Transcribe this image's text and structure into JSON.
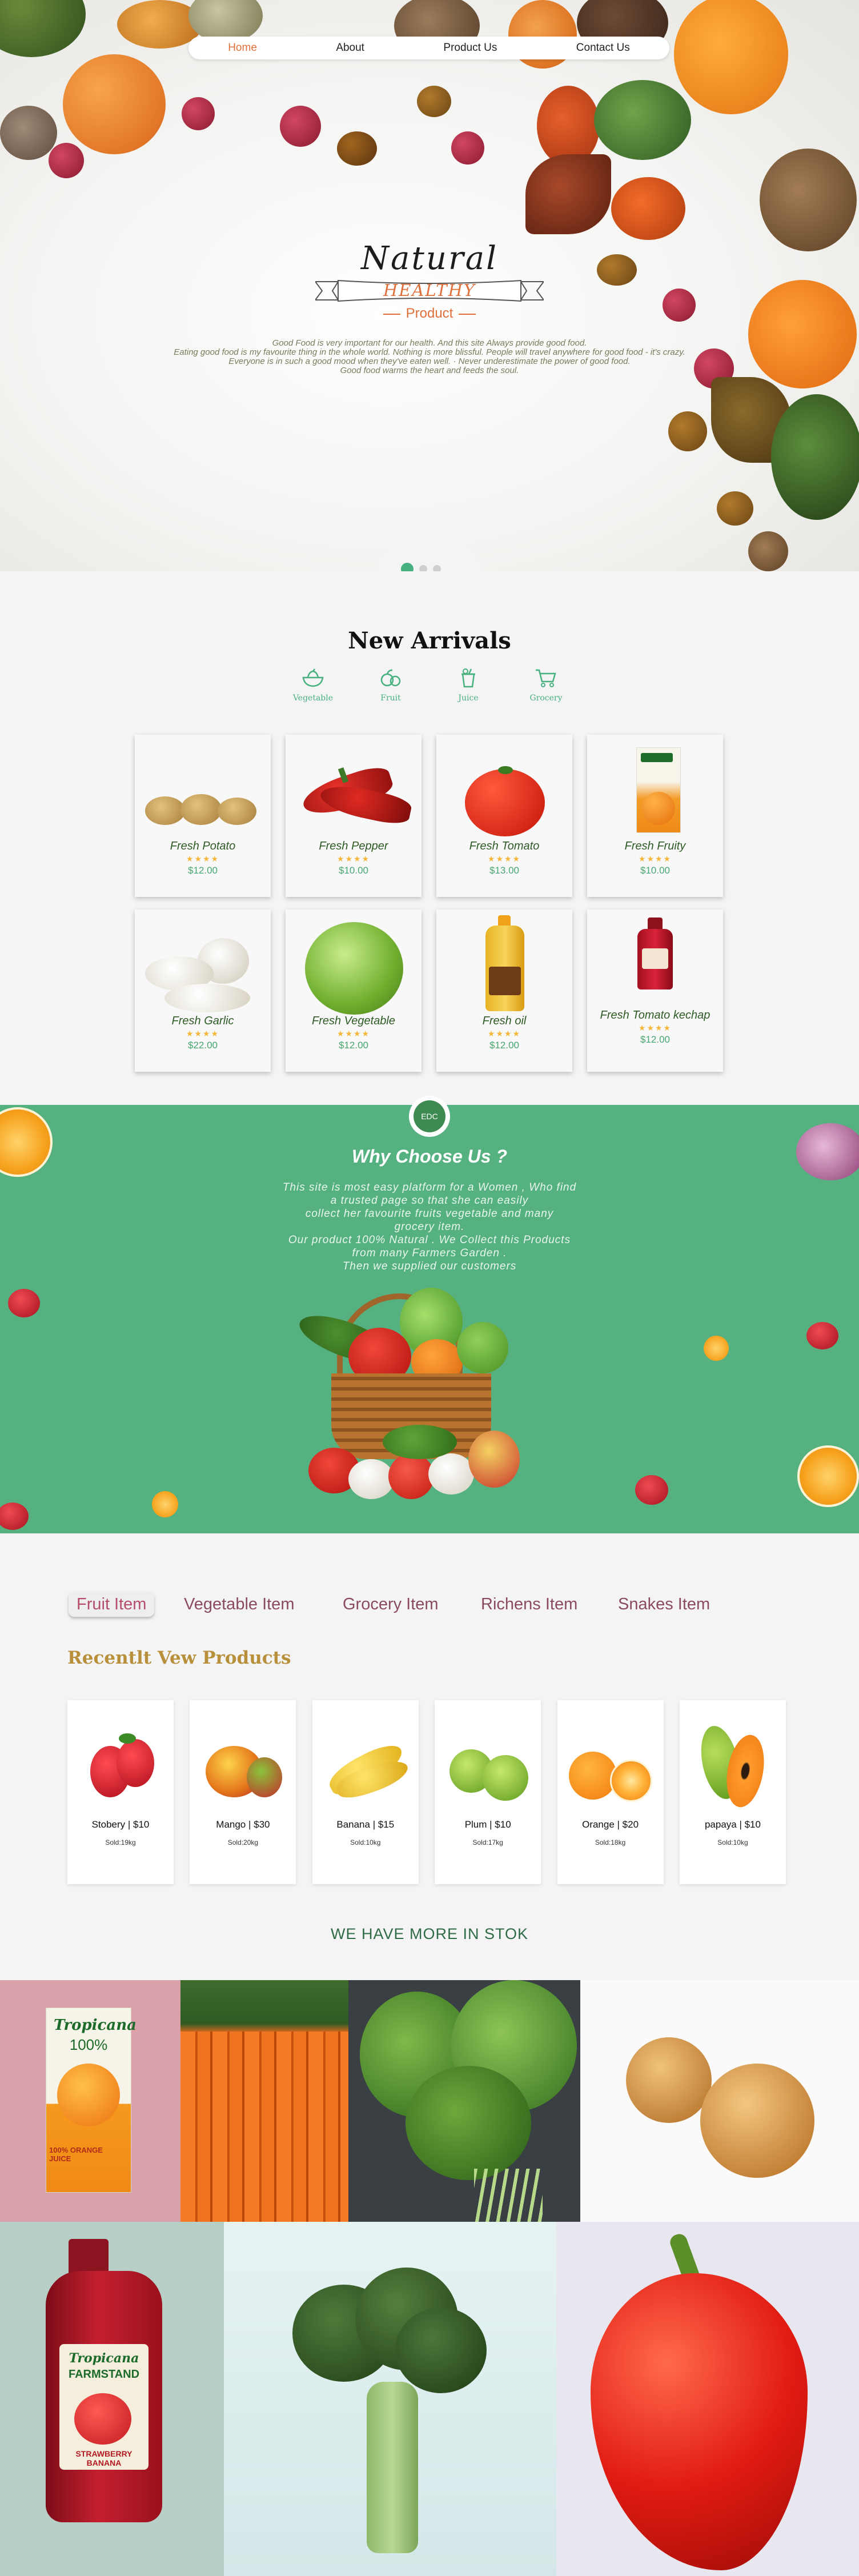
{
  "nav": {
    "items": [
      "Home",
      "About",
      "Product Us",
      "Contact Us"
    ],
    "active_color": "#e0703b"
  },
  "hero": {
    "title": "Natural",
    "ribbon": "HEALTHY",
    "subtitle": "Product",
    "description": [
      "Good Food is very important for our health. And this site Always provide good food.",
      "Eating good food is my favourite thing in the whole world. Nothing is more blissful. People will travel anywhere for good food - it's crazy.",
      "Everyone is in such a good mood when they've eaten well. · Never underestimate the power of good food.",
      "Good food warms the heart and feeds the soul."
    ],
    "slider": {
      "count": 3,
      "active": 1
    }
  },
  "arrivals": {
    "title_light": "New",
    "title_bold": "Arrivals",
    "categories": [
      {
        "label": "Vegetable",
        "icon": "vegetable-bowl-icon"
      },
      {
        "label": "Fruit",
        "icon": "fruit-icon"
      },
      {
        "label": "Juice",
        "icon": "juice-cup-icon"
      },
      {
        "label": "Grocery",
        "icon": "cart-icon"
      }
    ],
    "rating_stars": "★★★★",
    "products": [
      {
        "name": "Fresh Potato",
        "price": "$12.00"
      },
      {
        "name": "Fresh Pepper",
        "price": "$10.00"
      },
      {
        "name": "Fresh Tomato",
        "price": "$13.00"
      },
      {
        "name": "Fresh Fruity",
        "price": "$10.00"
      },
      {
        "name": "Fresh Garlic",
        "price": "$22.00"
      },
      {
        "name": "Fresh Vegetable",
        "price": "$12.00"
      },
      {
        "name": "Fresh oil",
        "price": "$12.00"
      },
      {
        "name": "Fresh Tomato kechap",
        "price": "$12.00"
      }
    ]
  },
  "why": {
    "badge": "EDC",
    "title": "Why Choose Us ?",
    "lines": [
      "This site is most easy platform for  a Women , Who find",
      "a trusted page so that she can easily",
      "collect her favourite fruits  vegetable  and many",
      "grocery item.",
      "Our product 100% Natural . We Collect this Products",
      "from many Farmers Garden .",
      "Then we supplied our customers"
    ],
    "background": "#55b180"
  },
  "tabs": [
    "Fruit Item",
    "Vegetable  Item",
    "Grocery Item",
    "Richens Item",
    "Snakes Item"
  ],
  "recent": {
    "title": "Recentlt Vew Products",
    "items": [
      {
        "label": "Stobery | $10",
        "sold": "Sold:19kg"
      },
      {
        "label": "Mango | $30",
        "sold": "Sold:20kg"
      },
      {
        "label": "Banana | $15",
        "sold": "Sold:10kg"
      },
      {
        "label": "Plum | $10",
        "sold": "Sold:17kg"
      },
      {
        "label": "Orange | $20",
        "sold": "Sold:18kg"
      },
      {
        "label": "papaya | $10",
        "sold": "Sold:10kg"
      }
    ]
  },
  "more_text": "WE HAVE MORE IN STOK",
  "gallery": {
    "tropicana_brand": "Tropicana",
    "tropicana_sub": "100%",
    "tropicana_flavor": "100% ORANGE JUICE",
    "farmstand_brand": "Tropicana",
    "farmstand_sub": "FARMSTAND",
    "farmstand_flavor": "STRAWBERRY BANANA"
  }
}
